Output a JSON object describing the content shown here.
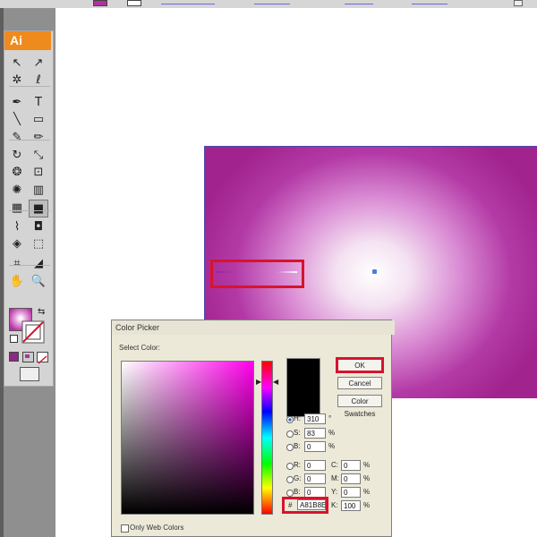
{
  "app": {
    "logo": "Ai"
  },
  "tools": [
    {
      "name": "selection-tool",
      "glyph": "↖"
    },
    {
      "name": "direct-selection-tool",
      "glyph": "↗"
    },
    {
      "name": "magic-wand-tool",
      "glyph": "✲"
    },
    {
      "name": "lasso-tool",
      "glyph": "ℓ"
    },
    {
      "name": "pen-tool",
      "glyph": "✒"
    },
    {
      "name": "type-tool",
      "glyph": "T"
    },
    {
      "name": "line-tool",
      "glyph": "╲"
    },
    {
      "name": "rectangle-tool",
      "glyph": "▭"
    },
    {
      "name": "paintbrush-tool",
      "glyph": "✎"
    },
    {
      "name": "pencil-tool",
      "glyph": "✏"
    },
    {
      "name": "rotate-tool",
      "glyph": "↻"
    },
    {
      "name": "scale-tool",
      "glyph": "⤡"
    },
    {
      "name": "warp-tool",
      "glyph": "❂"
    },
    {
      "name": "free-transform-tool",
      "glyph": "⊡"
    },
    {
      "name": "symbol-sprayer-tool",
      "glyph": "✺"
    },
    {
      "name": "column-graph-tool",
      "glyph": "▥"
    },
    {
      "name": "mesh-tool",
      "glyph": "▦"
    },
    {
      "name": "gradient-tool",
      "glyph": "■"
    },
    {
      "name": "eyedropper-tool",
      "glyph": "⌇"
    },
    {
      "name": "blend-tool",
      "glyph": "◘"
    },
    {
      "name": "live-paint-bucket-tool",
      "glyph": "◈"
    },
    {
      "name": "live-paint-selection-tool",
      "glyph": "⬚"
    },
    {
      "name": "slice-tool",
      "glyph": "⌗"
    },
    {
      "name": "eraser-tool",
      "glyph": "◢"
    },
    {
      "name": "hand-tool",
      "glyph": "✋"
    },
    {
      "name": "zoom-tool",
      "glyph": "🔍"
    }
  ],
  "swatches": {
    "fill": "#b3309f",
    "stroke": "#ffffff",
    "accent": "#d8132c"
  },
  "color_picker": {
    "title": "Color Picker",
    "select_label": "Select Color:",
    "ok": "OK",
    "cancel": "Cancel",
    "swatches": "Color Swatches",
    "hsb": [
      {
        "label": "H:",
        "value": "310",
        "unit": "°",
        "selected": true
      },
      {
        "label": "S:",
        "value": "83",
        "unit": "%",
        "selected": false
      },
      {
        "label": "B:",
        "value": "0",
        "unit": "%",
        "selected": false
      }
    ],
    "rgb": [
      {
        "label": "R:",
        "value": "0"
      },
      {
        "label": "G:",
        "value": "0"
      },
      {
        "label": "B:",
        "value": "0"
      }
    ],
    "cmyk": [
      {
        "label": "C:",
        "value": "0",
        "unit": "%"
      },
      {
        "label": "M:",
        "value": "0",
        "unit": "%"
      },
      {
        "label": "Y:",
        "value": "0",
        "unit": "%"
      },
      {
        "label": "K:",
        "value": "100",
        "unit": "%"
      }
    ],
    "hex_label": "#",
    "hex": "A81B8E",
    "web_colors": "Only Web Colors"
  }
}
